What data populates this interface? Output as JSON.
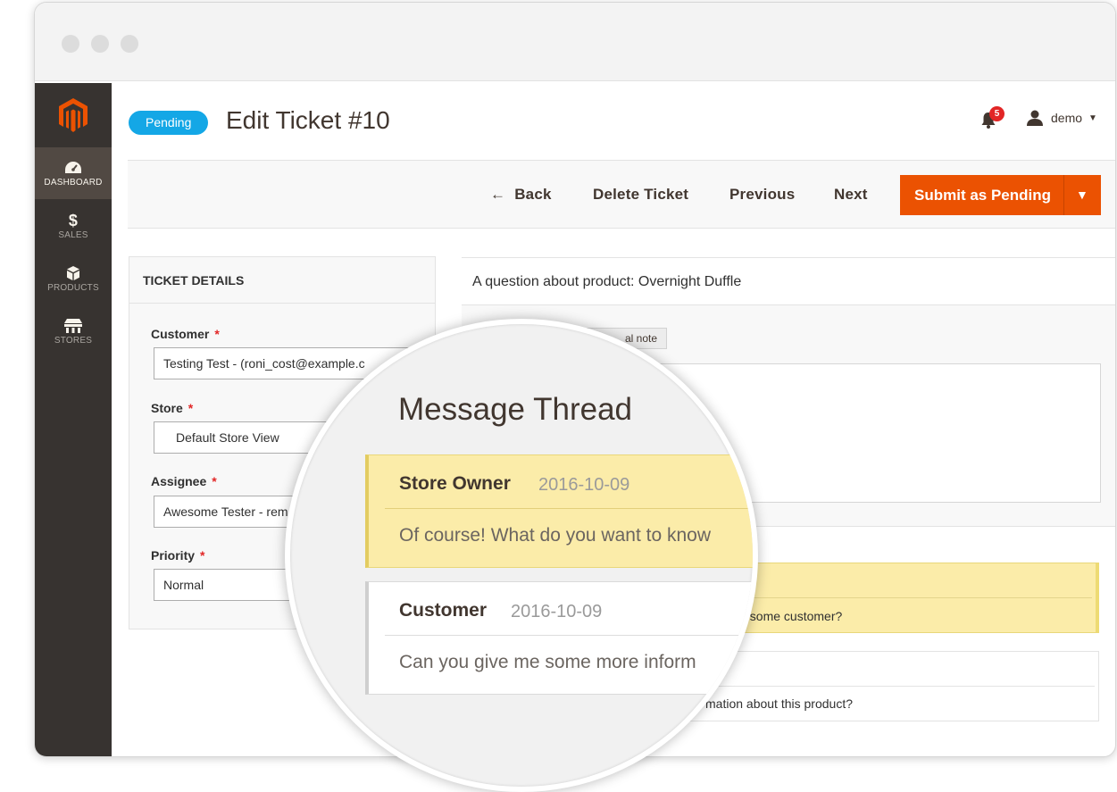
{
  "status_badge": "Pending",
  "page_title": "Edit Ticket #10",
  "header": {
    "notification_count": "5",
    "username": "demo"
  },
  "sidebar": {
    "items": [
      {
        "label": "Dashboard",
        "icon": "dashboard-icon",
        "active": true
      },
      {
        "label": "Sales",
        "icon": "dollar-icon"
      },
      {
        "label": "Products",
        "icon": "box-icon"
      },
      {
        "label": "Stores",
        "icon": "store-icon"
      }
    ]
  },
  "toolbar": {
    "back_label": "Back",
    "delete_label": "Delete Ticket",
    "previous_label": "Previous",
    "next_label": "Next",
    "submit_label": "Submit as Pending"
  },
  "ticket_details": {
    "title": "Ticket Details",
    "customer": {
      "label": "Customer",
      "value": "Testing Test - (roni_cost@example.c"
    },
    "store": {
      "label": "Store",
      "value": "Default Store View"
    },
    "assignee": {
      "label": "Assignee",
      "value": "Awesome Tester - rem"
    },
    "priority": {
      "label": "Priority",
      "value": "Normal"
    }
  },
  "subject": "A question about product: Overnight Duffle",
  "reply": {
    "tab_label": "al note"
  },
  "thread_background": {
    "msg1_text": "esome customer?",
    "msg2_text": "mation about this product?"
  },
  "magnifier": {
    "title": "Message Thread",
    "messages": [
      {
        "author": "Store Owner",
        "date": "2016-10-09",
        "text": "Of course! What do you want to know"
      },
      {
        "author": "Customer",
        "date": "2016-10-09",
        "text": "Can you give me some more inform"
      }
    ]
  },
  "colors": {
    "accent": "#eb5202",
    "badge": "#14a7e6",
    "sidebar": "#373330",
    "owner_message": "#fbeca9"
  }
}
